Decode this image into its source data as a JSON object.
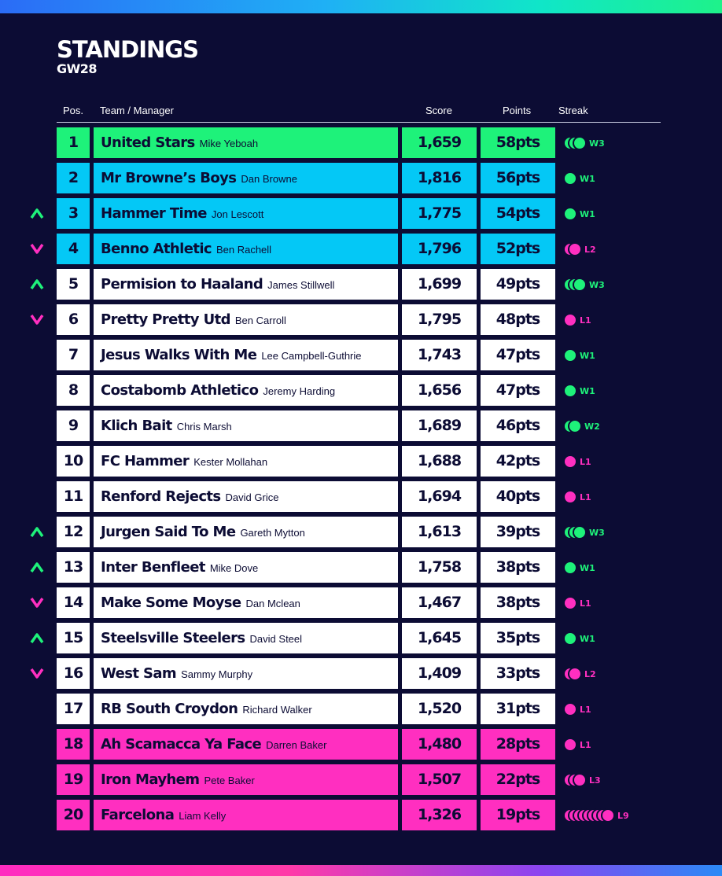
{
  "header": {
    "title": "STANDINGS",
    "subtitle": "GW28"
  },
  "columns": {
    "pos": "Pos.",
    "team": "Team / Manager",
    "score": "Score",
    "points": "Points",
    "streak": "Streak"
  },
  "colors": {
    "background": "#0c0c34",
    "win": "#1ef27a",
    "loss": "#ff2fc0",
    "champion": "#1ef27a",
    "european": "#04c8f6",
    "relegation": "#ff2fc0"
  },
  "rows": [
    {
      "pos": "1",
      "team": "United Stars",
      "manager": "Mike Yeboah",
      "score": "1,659",
      "points": "58pts",
      "streak": "W3",
      "count": 3,
      "result": "W",
      "move": "none",
      "tier": "green"
    },
    {
      "pos": "2",
      "team": "Mr Browne’s Boys",
      "manager": "Dan Browne",
      "score": "1,816",
      "points": "56pts",
      "streak": "W1",
      "count": 1,
      "result": "W",
      "move": "none",
      "tier": "blue"
    },
    {
      "pos": "3",
      "team": "Hammer Time",
      "manager": "Jon Lescott",
      "score": "1,775",
      "points": "54pts",
      "streak": "W1",
      "count": 1,
      "result": "W",
      "move": "up",
      "tier": "blue"
    },
    {
      "pos": "4",
      "team": "Benno Athletic",
      "manager": "Ben Rachell",
      "score": "1,796",
      "points": "52pts",
      "streak": "L2",
      "count": 2,
      "result": "L",
      "move": "down",
      "tier": "blue"
    },
    {
      "pos": "5",
      "team": "Permision to Haaland",
      "manager": "James Stillwell",
      "score": "1,699",
      "points": "49pts",
      "streak": "W3",
      "count": 3,
      "result": "W",
      "move": "up",
      "tier": "white"
    },
    {
      "pos": "6",
      "team": "Pretty Pretty Utd",
      "manager": "Ben Carroll",
      "score": "1,795",
      "points": "48pts",
      "streak": "L1",
      "count": 1,
      "result": "L",
      "move": "down",
      "tier": "white"
    },
    {
      "pos": "7",
      "team": "Jesus Walks With Me",
      "manager": "Lee Campbell-Guthrie",
      "score": "1,743",
      "points": "47pts",
      "streak": "W1",
      "count": 1,
      "result": "W",
      "move": "none",
      "tier": "white"
    },
    {
      "pos": "8",
      "team": "Costabomb Athletico",
      "manager": "Jeremy Harding",
      "score": "1,656",
      "points": "47pts",
      "streak": "W1",
      "count": 1,
      "result": "W",
      "move": "none",
      "tier": "white"
    },
    {
      "pos": "9",
      "team": "Klich Bait",
      "manager": "Chris Marsh",
      "score": "1,689",
      "points": "46pts",
      "streak": "W2",
      "count": 2,
      "result": "W",
      "move": "none",
      "tier": "white"
    },
    {
      "pos": "10",
      "team": "FC Hammer",
      "manager": "Kester Mollahan",
      "score": "1,688",
      "points": "42pts",
      "streak": "L1",
      "count": 1,
      "result": "L",
      "move": "none",
      "tier": "white"
    },
    {
      "pos": "11",
      "team": "Renford Rejects",
      "manager": "David Grice",
      "score": "1,694",
      "points": "40pts",
      "streak": "L1",
      "count": 1,
      "result": "L",
      "move": "none",
      "tier": "white"
    },
    {
      "pos": "12",
      "team": "Jurgen Said To Me",
      "manager": "Gareth Mytton",
      "score": "1,613",
      "points": "39pts",
      "streak": "W3",
      "count": 3,
      "result": "W",
      "move": "up",
      "tier": "white"
    },
    {
      "pos": "13",
      "team": "Inter Benfleet",
      "manager": "Mike Dove",
      "score": "1,758",
      "points": "38pts",
      "streak": "W1",
      "count": 1,
      "result": "W",
      "move": "up",
      "tier": "white"
    },
    {
      "pos": "14",
      "team": "Make Some Moyse",
      "manager": "Dan Mclean",
      "score": "1,467",
      "points": "38pts",
      "streak": "L1",
      "count": 1,
      "result": "L",
      "move": "down",
      "tier": "white"
    },
    {
      "pos": "15",
      "team": "Steelsville Steelers",
      "manager": "David Steel",
      "score": "1,645",
      "points": "35pts",
      "streak": "W1",
      "count": 1,
      "result": "W",
      "move": "up",
      "tier": "white"
    },
    {
      "pos": "16",
      "team": "West Sam",
      "manager": "Sammy Murphy",
      "score": "1,409",
      "points": "33pts",
      "streak": "L2",
      "count": 2,
      "result": "L",
      "move": "down",
      "tier": "white"
    },
    {
      "pos": "17",
      "team": "RB South Croydon",
      "manager": "Richard Walker",
      "score": "1,520",
      "points": "31pts",
      "streak": "L1",
      "count": 1,
      "result": "L",
      "move": "none",
      "tier": "white"
    },
    {
      "pos": "18",
      "team": "Ah Scamacca Ya Face",
      "manager": "Darren Baker",
      "score": "1,480",
      "points": "28pts",
      "streak": "L1",
      "count": 1,
      "result": "L",
      "move": "none",
      "tier": "pink"
    },
    {
      "pos": "19",
      "team": "Iron Mayhem",
      "manager": "Pete Baker",
      "score": "1,507",
      "points": "22pts",
      "streak": "L3",
      "count": 3,
      "result": "L",
      "move": "none",
      "tier": "pink"
    },
    {
      "pos": "20",
      "team": "Farcelona",
      "manager": "Liam Kelly",
      "score": "1,326",
      "points": "19pts",
      "streak": "L9",
      "count": 9,
      "result": "L",
      "move": "none",
      "tier": "pink"
    }
  ]
}
